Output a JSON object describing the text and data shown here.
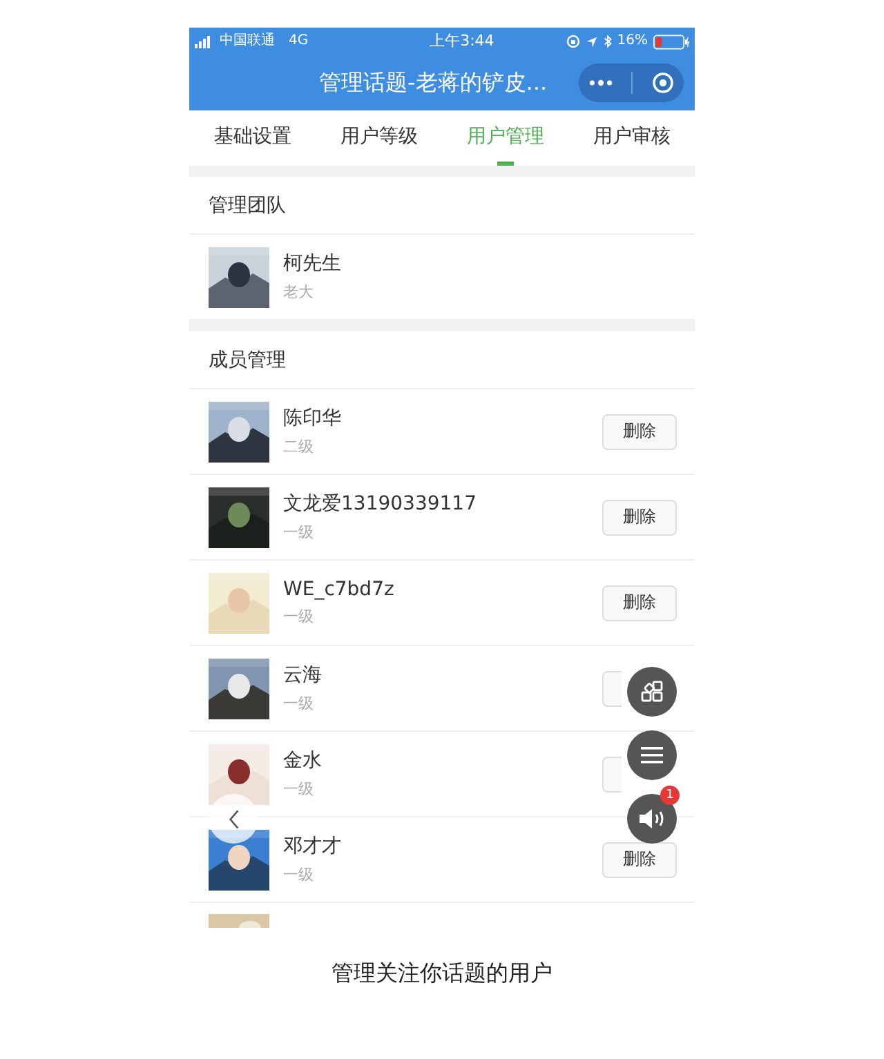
{
  "status_bar": {
    "carrier": "中国联通",
    "network": "4G",
    "time": "上午3:44",
    "battery": "16%"
  },
  "nav": {
    "title": "管理话题-老蒋的铲皮..."
  },
  "tabs": [
    {
      "label": "基础设置",
      "selected": false
    },
    {
      "label": "用户等级",
      "selected": false
    },
    {
      "label": "用户管理",
      "selected": true
    },
    {
      "label": "用户审核",
      "selected": false
    }
  ],
  "sections": [
    {
      "title": "管理团队",
      "members": [
        {
          "name": "柯先生",
          "level": "老大",
          "kind": "owner"
        }
      ]
    },
    {
      "title": "成员管理",
      "members": [
        {
          "name": "陈印华",
          "level": "二级",
          "kind": "member",
          "action": "删除"
        },
        {
          "name": "文龙爱13190339117",
          "level": "一级",
          "kind": "member",
          "action": "删除"
        },
        {
          "name": "WE_c7bd7z",
          "level": "一级",
          "kind": "member",
          "action": "删除"
        },
        {
          "name": "云海",
          "level": "一级",
          "kind": "member_covered"
        },
        {
          "name": "金水",
          "level": "一级",
          "kind": "member_covered"
        },
        {
          "name": "邓才才",
          "level": "一级",
          "kind": "member",
          "action": "删除"
        }
      ]
    }
  ],
  "floating": {
    "badge": "1"
  },
  "caption": "管理关注你话题的用户"
}
